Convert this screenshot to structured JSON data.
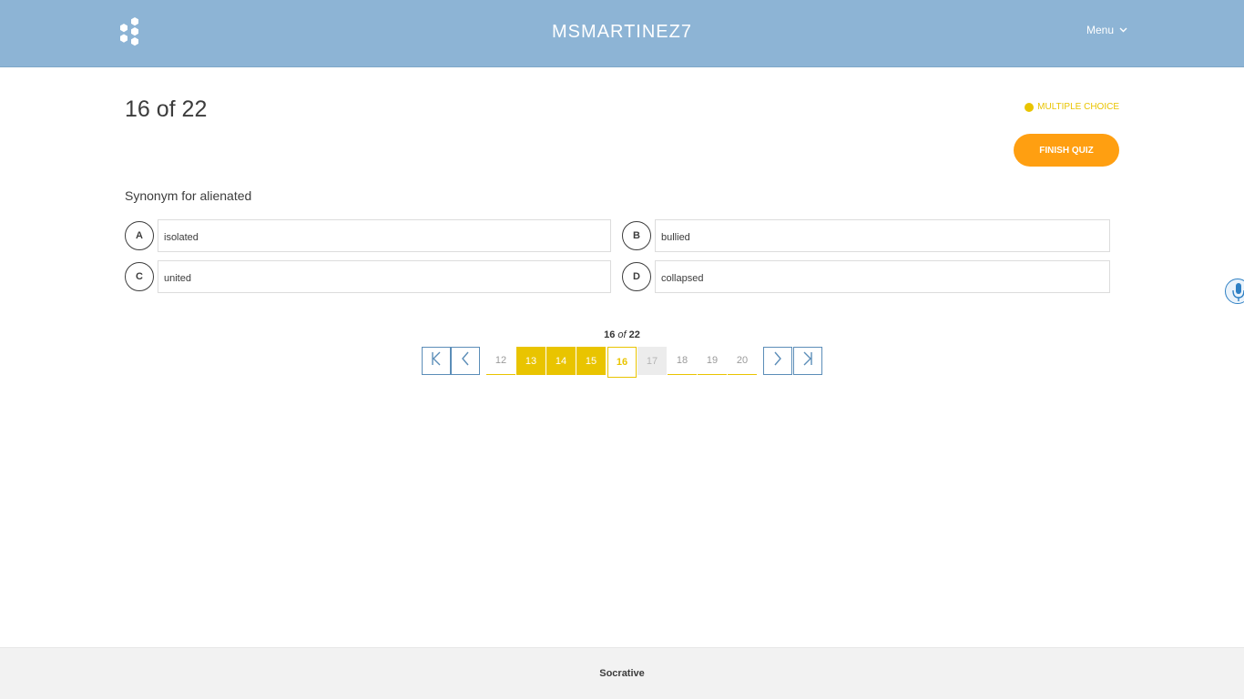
{
  "header": {
    "room_name": "MSMARTINEZ7",
    "menu_label": "Menu",
    "logo_icon": "hexagon-cluster-icon",
    "background_color": "#8db4d5"
  },
  "question": {
    "counter": "16 of 22",
    "type_label": "MULTIPLE CHOICE",
    "text": "Synonym for alienated"
  },
  "actions": {
    "finish_label": "FINISH QUIZ",
    "finish_color": "#ff9f11"
  },
  "answers": [
    {
      "letter": "A",
      "text": "isolated"
    },
    {
      "letter": "B",
      "text": "bullied"
    },
    {
      "letter": "C",
      "text": "united"
    },
    {
      "letter": "D",
      "text": "collapsed"
    }
  ],
  "pagination": {
    "current": "16",
    "of_word": "of",
    "total": "22",
    "pages": [
      {
        "label": "12",
        "state": "default"
      },
      {
        "label": "13",
        "state": "answered"
      },
      {
        "label": "14",
        "state": "answered"
      },
      {
        "label": "15",
        "state": "answered"
      },
      {
        "label": "16",
        "state": "current"
      },
      {
        "label": "17",
        "state": "skipped"
      },
      {
        "label": "18",
        "state": "default"
      },
      {
        "label": "19",
        "state": "default"
      },
      {
        "label": "20",
        "state": "default"
      }
    ],
    "accent_color": "#e9c400"
  },
  "footer": {
    "brand": "Socrative"
  }
}
